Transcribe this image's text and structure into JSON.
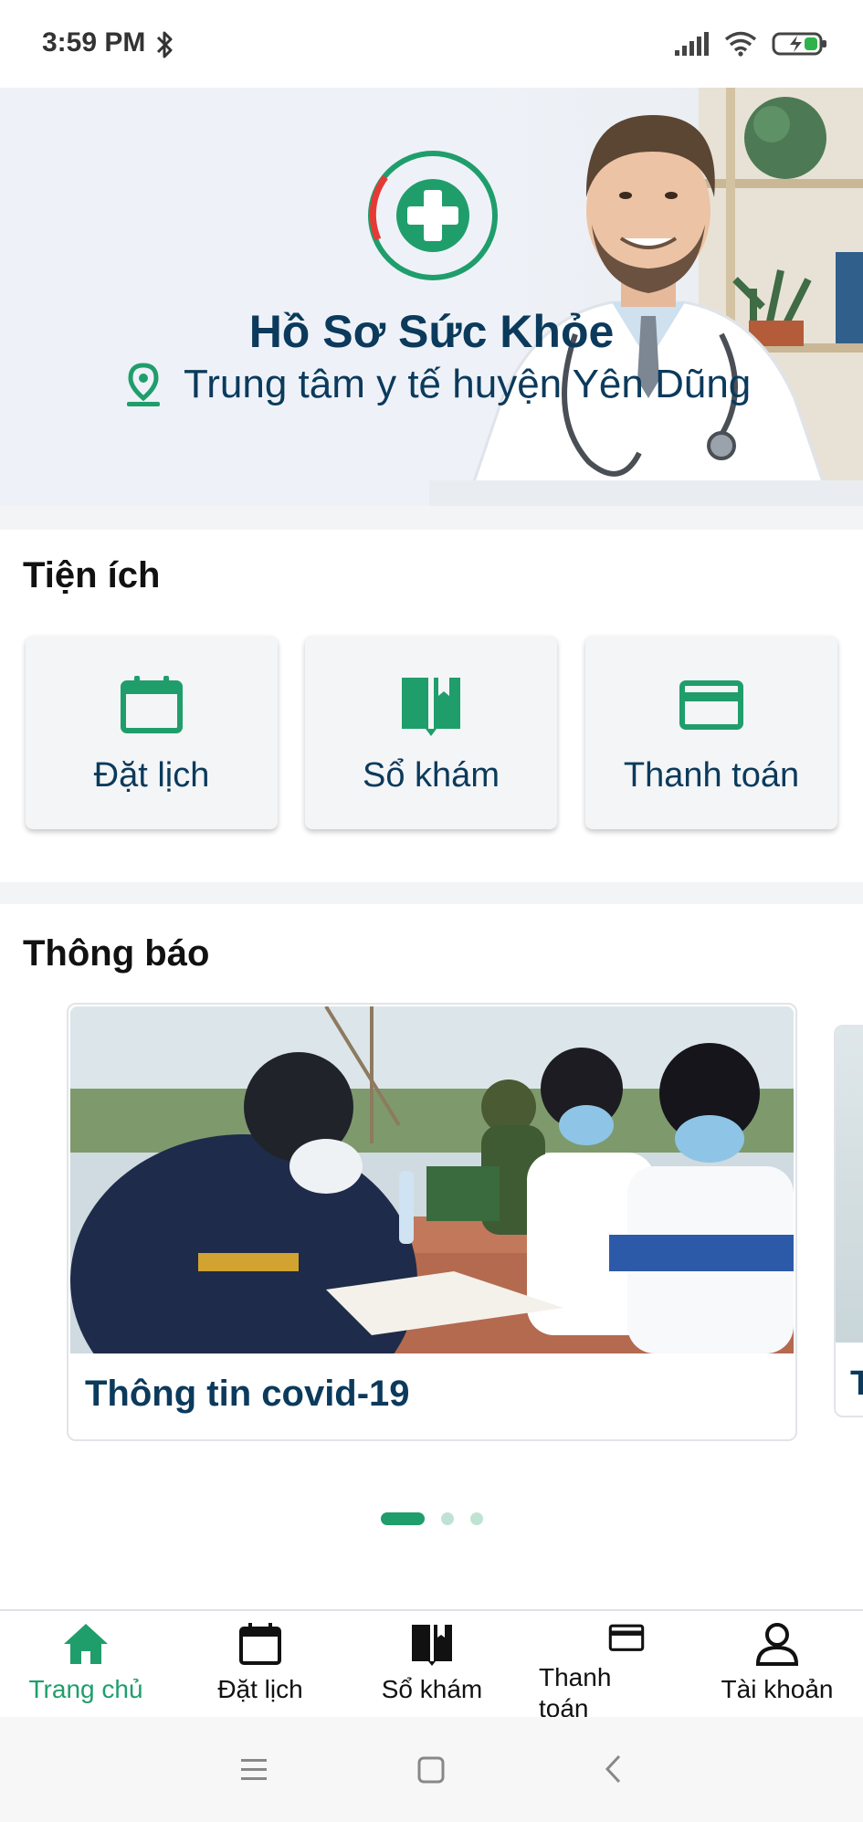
{
  "status_bar": {
    "time": "3:59 PM"
  },
  "hero": {
    "title": "Hồ Sơ Sức Khỏe",
    "location": "Trung tâm y tế huyện Yên Dũng"
  },
  "utilities": {
    "title": "Tiện ích",
    "items": [
      {
        "label": "Đặt lịch",
        "icon": "calendar-icon"
      },
      {
        "label": "Sổ khám",
        "icon": "book-icon"
      },
      {
        "label": "Thanh toán",
        "icon": "credit-card-icon"
      }
    ]
  },
  "notifications": {
    "title": "Thông báo",
    "cards": [
      {
        "title": "Thông tin covid-19"
      },
      {
        "title": "T"
      }
    ],
    "page_count": 3,
    "active_page": 1
  },
  "bottom_nav": {
    "items": [
      {
        "label": "Trang chủ",
        "icon": "home-icon",
        "active": true
      },
      {
        "label": "Đặt lịch",
        "icon": "calendar-icon",
        "active": false
      },
      {
        "label": "Sổ khám",
        "icon": "book-icon",
        "active": false
      },
      {
        "label": "Thanh toán",
        "icon": "credit-card-icon",
        "active": false
      },
      {
        "label": "Tài khoản",
        "icon": "user-icon",
        "active": false
      }
    ]
  },
  "colors": {
    "brand_green": "#1f9e6b",
    "navy_text": "#0b3a5c",
    "logo_red": "#e53935"
  }
}
